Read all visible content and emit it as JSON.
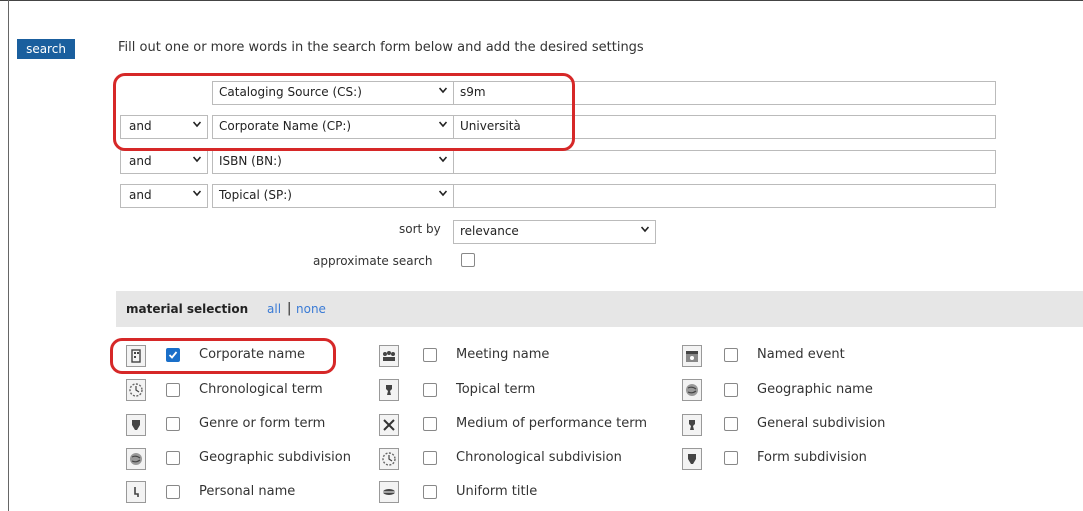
{
  "search_tab": "search",
  "instructions": "Fill out one or more words in the search form below and add the desired settings",
  "rows": [
    {
      "bool": "",
      "field": "Cataloging Source (CS:)",
      "value": "s9m"
    },
    {
      "bool": "and",
      "field": "Corporate Name (CP:)",
      "value": "Università"
    },
    {
      "bool": "and",
      "field": "ISBN (BN:)",
      "value": ""
    },
    {
      "bool": "and",
      "field": "Topical (SP:)",
      "value": ""
    }
  ],
  "sort": {
    "label": "sort by",
    "value": "relevance"
  },
  "approximate": {
    "label": "approximate search",
    "checked": false
  },
  "material": {
    "heading": "material selection",
    "all": "all",
    "separator": "|",
    "none": "none",
    "items": [
      {
        "label": "Corporate name",
        "checked": true,
        "icon": "corporate-name-icon"
      },
      {
        "label": "Meeting name",
        "checked": false,
        "icon": "meeting-name-icon"
      },
      {
        "label": "Named event",
        "checked": false,
        "icon": "named-event-icon"
      },
      {
        "label": "Chronological term",
        "checked": false,
        "icon": "chronological-term-icon"
      },
      {
        "label": "Topical term",
        "checked": false,
        "icon": "topical-term-icon"
      },
      {
        "label": "Geographic name",
        "checked": false,
        "icon": "geographic-name-icon"
      },
      {
        "label": "Genre or form term",
        "checked": false,
        "icon": "genre-form-icon"
      },
      {
        "label": "Medium of performance term",
        "checked": false,
        "icon": "medium-performance-icon"
      },
      {
        "label": "General subdivision",
        "checked": false,
        "icon": "general-subdivision-icon"
      },
      {
        "label": "Geographic subdivision",
        "checked": false,
        "icon": "geographic-subdivision-icon"
      },
      {
        "label": "Chronological subdivision",
        "checked": false,
        "icon": "chronological-subdivision-icon"
      },
      {
        "label": "Form subdivision",
        "checked": false,
        "icon": "form-subdivision-icon"
      },
      {
        "label": "Personal name",
        "checked": false,
        "icon": "personal-name-icon"
      },
      {
        "label": "Uniform title",
        "checked": false,
        "icon": "uniform-title-icon"
      }
    ]
  },
  "colors": {
    "accent": "#1a5f9e",
    "highlight": "#d62828",
    "link": "#3a7bd5",
    "bar": "#e6e6e6"
  }
}
